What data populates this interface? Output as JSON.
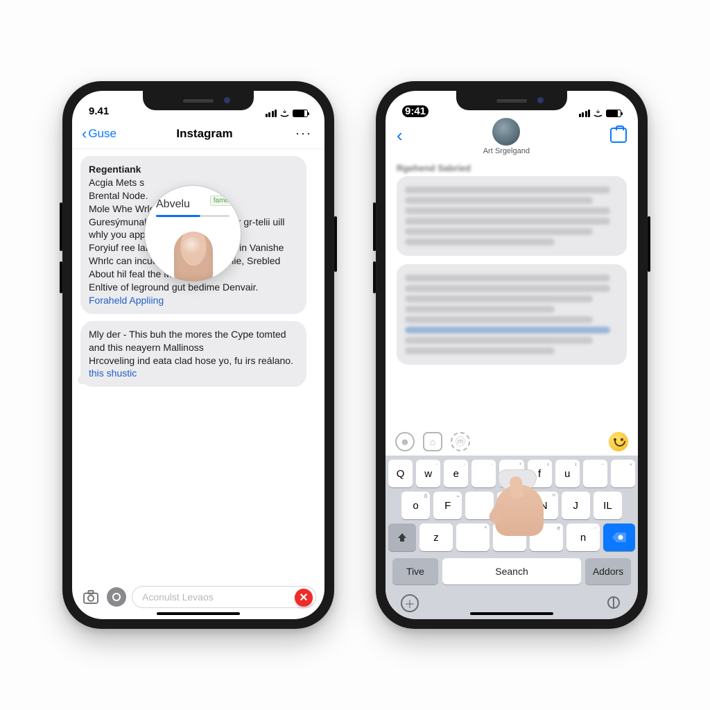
{
  "left": {
    "status": {
      "time": "9.41"
    },
    "nav": {
      "backLabel": "Guse",
      "title": "Instagram",
      "more": "···"
    },
    "magnifier": {
      "label": "Abvelu",
      "tag": "fame"
    },
    "bubble1": {
      "heading": "Regentiank",
      "body": "Acgia Mets s\nBrental Node.\nMole Whe Wrle                       thent\nGuresýmunal Is an                   angut fhandpїur gr‑telii uill whly you appe?\nForyiuf ree lata ble worlc Change I in Vanishe Whrlc can incued on Instage Replie,  Srebled About hil feal the Mescake,\nEnltive of leground gut bedime Denvair.",
      "link": "Foraheld Appliing"
    },
    "bubble2": {
      "body": "Mly der - This buh the mores the Cype tomted and this neayern Mallinoss\nHrcoveling ind eata clad hose yo, fu irs reálano.",
      "link": "this shustic"
    },
    "input": {
      "placeholder": "Aconulst Levaos"
    }
  },
  "right": {
    "status": {
      "time": "9:41"
    },
    "header": {
      "name": "Art Srgelgand"
    },
    "blurHeading": "Rgehend Sabried",
    "keyboard": {
      "row1": [
        "Q",
        "w",
        "e",
        " ",
        "T",
        "f",
        "u",
        " ",
        " "
      ],
      "row1_sup": [
        "",
        "·",
        "·",
        "·",
        "¹",
        "ı",
        "ı",
        "··",
        "·‹"
      ],
      "row2_letters": [
        "o",
        "F",
        "",
        "H",
        "N",
        "J",
        "IL"
      ],
      "row2_sup": [
        "ô",
        "¬",
        "",
        "·",
        "ᴴ",
        "",
        "",
        ""
      ],
      "row3_letters": [
        "z",
        "",
        "",
        "",
        "n"
      ],
      "row3_sup": [
        "",
        "ᵏ",
        "",
        "e",
        "··"
      ],
      "bottom": {
        "left": "Tive",
        "center": "Seanch",
        "right": "Addors"
      }
    }
  }
}
